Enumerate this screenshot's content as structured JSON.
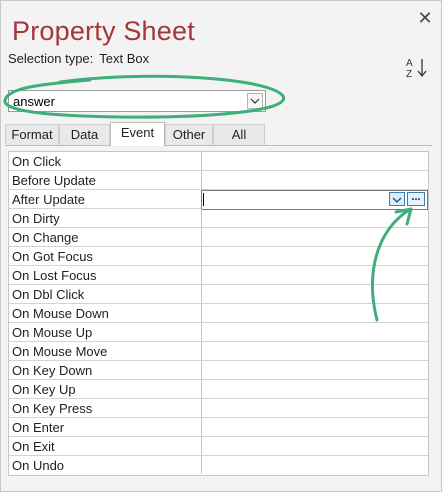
{
  "title": "Property Sheet",
  "selection": {
    "label": "Selection type:",
    "value": "Text Box"
  },
  "object_combo": {
    "value": "answer"
  },
  "tabs": [
    {
      "label": "Format",
      "active": false
    },
    {
      "label": "Data",
      "active": false
    },
    {
      "label": "Event",
      "active": true
    },
    {
      "label": "Other",
      "active": false
    },
    {
      "label": "All",
      "active": false
    }
  ],
  "properties": [
    {
      "name": "On Click"
    },
    {
      "name": "Before Update"
    },
    {
      "name": "After Update"
    },
    {
      "name": "On Dirty"
    },
    {
      "name": "On Change"
    },
    {
      "name": "On Got Focus"
    },
    {
      "name": "On Lost Focus"
    },
    {
      "name": "On Dbl Click"
    },
    {
      "name": "On Mouse Down"
    },
    {
      "name": "On Mouse Up"
    },
    {
      "name": "On Mouse Move"
    },
    {
      "name": "On Key Down"
    },
    {
      "name": "On Key Up"
    },
    {
      "name": "On Key Press"
    },
    {
      "name": "On Enter"
    },
    {
      "name": "On Exit"
    },
    {
      "name": "On Undo"
    }
  ],
  "build_button": {
    "label": "..."
  },
  "colors": {
    "title": "#a4373a",
    "annotation": "#3fae7a",
    "button_border": "#3c7fb1"
  }
}
